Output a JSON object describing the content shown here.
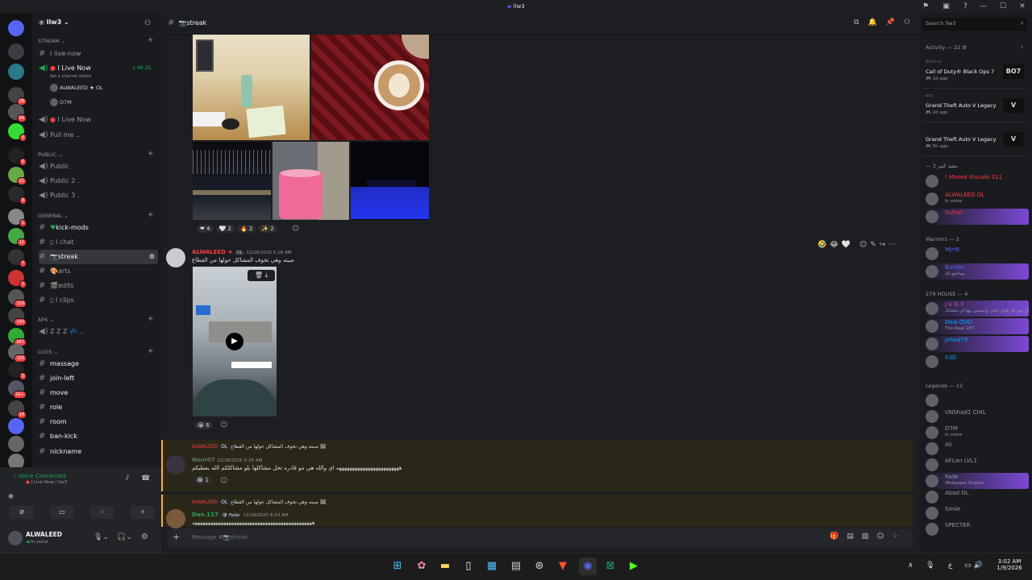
{
  "window": {
    "title": "llw3",
    "controls": [
      "—",
      "☐",
      "✕"
    ]
  },
  "server": {
    "name": "llw3"
  },
  "categories": {
    "stream": "Stream",
    "public": "Public",
    "general": "GENERAL",
    "afk": "AFK",
    "logs": "LOGS"
  },
  "channels": {
    "live_now_1": "I live-now",
    "voice_live": "I Live Now",
    "voice_live_time": "1:48:25",
    "channel_status": "Set a channel status",
    "vu1": "ALWALEED",
    "vu1_tag": "OL",
    "vu2": "D7M",
    "voice_live2": "I Live Now",
    "pull": "Pull me ..",
    "public": "Public",
    "public2": "Public 2 .",
    "public3": "Public 3 .",
    "kickmods": "kick-mods",
    "chat": "I chat",
    "streak": "streak",
    "arts": "arts",
    "edits": "edits",
    "clips": "I clips",
    "zzz": "Z Z Z",
    "massage": "massage",
    "joinleft": "join-left",
    "move": "move",
    "role": "role",
    "room": "room",
    "bankick": "ban-kick",
    "nickname": "nickname"
  },
  "server_badges": [
    "28",
    "64",
    "6",
    "6",
    "21",
    "6",
    "1",
    "11",
    "7",
    "3",
    "219",
    "145",
    "847",
    "103",
    "5",
    "1K+",
    "14"
  ],
  "voice": {
    "status": "Voice Connected",
    "detail": "I Live Now / llw3"
  },
  "user": {
    "name": "ALWALEED",
    "status": "In voice"
  },
  "header": {
    "channel": "streak"
  },
  "search": {
    "placeholder": "Search llw3"
  },
  "messages": {
    "reactions1": [
      {
        "e": "❤",
        "c": "4"
      },
      {
        "e": "🤍",
        "c": "2"
      },
      {
        "e": "🔥",
        "c": "2"
      },
      {
        "e": "✨",
        "c": "2"
      }
    ],
    "m1": {
      "author": "ALWALEED",
      "tag": "OL",
      "time": "12/28/2025 5:16 AM",
      "text": "صيته وهي تخوف المشاكل حولها من القطاع"
    },
    "reactions2": [
      {
        "e": "😭",
        "c": "6"
      }
    ],
    "m2": {
      "ref_author": "ALWALEED",
      "ref_tag": "OL",
      "ref_text": "صيته وهي تخوف المشاكل حولها من القطاع",
      "author": "Noor07",
      "time": "12/28/2025 5:35 AM",
      "text": "ههههههههههههههههههههههههه اي والله هي مو قادره تحل مشاكلها بلو مشاكلكم الله يعطيكم"
    },
    "reactions3": [
      {
        "e": "😂",
        "c": "1"
      }
    ],
    "m3": {
      "ref_author": "ALWALEED",
      "ref_tag": "OL",
      "ref_text": "صيته وهي تخوف المشاكل حولها من القطاع",
      "author": "Dan.117",
      "tag": "Fade",
      "time": "12/28/2025 6:53 AM",
      "text": "ههههههههههههههههههههههههههههههههههههههههههههههه"
    }
  },
  "composer": {
    "placeholder": "Message #📷streak"
  },
  "members": {
    "activity_title": "Activity — 22",
    "activities": [
      {
        "user": "Boshra",
        "game": "Call of Duty® Black Ops 7",
        "time": "1d ago",
        "logo": "BO7"
      },
      {
        "user": "abu",
        "game": "Grand Theft Auto V Legacy",
        "time": "2d ago",
        "logo": "V"
      },
      {
        "user": "...",
        "game": "Grand Theft Auto V Legacy",
        "time": "5h ago",
        "logo": "V"
      }
    ],
    "group1": "— 3 مفيد كبير",
    "g1": [
      {
        "name": "! Mosed Alsuabi",
        "tag": "511",
        "color": "#f23f43"
      },
      {
        "name": "ALWALEED",
        "tag": "OL",
        "sub": "In voice",
        "color": "#f23f43"
      },
      {
        "name": "Sultan",
        "color": "#f23f43"
      }
    ],
    "group2": "Warriors — 2",
    "g2": [
      {
        "name": "Mjrt6",
        "color": "#5865f2"
      },
      {
        "name": "Bander",
        "sub": "وماتنفع لك",
        "color": "#5865f2"
      }
    ],
    "group3": "279 HOUSE — 4",
    "g3": [
      {
        "name": "J U D Y",
        "sub": "أي يوم كل قليل دكتي وأحبيتني يبها لي عشانك",
        "color": "#eb459e"
      },
      {
        "name": "Dew",
        "tag": "OVO",
        "sub": "The Real 187",
        "color": "#00a8fc"
      },
      {
        "name": "Jehod79",
        "color": "#00a8fc"
      },
      {
        "name": "S3D",
        "color": "#00a8fc"
      }
    ],
    "group4": "Legends — 12",
    "g4": [
      {
        "name": "",
        "color": "#dbdee1"
      },
      {
        "name": "UNShad1",
        "tag": "CHIL",
        "color": "#949ba4"
      },
      {
        "name": "D7M",
        "sub": "In voice",
        "color": "#949ba4"
      },
      {
        "name": "Ali",
        "color": "#949ba4"
      },
      {
        "name": "AFLan",
        "tag": "LVL1",
        "color": "#949ba4"
      },
      {
        "name": "Fade",
        "sub": "Wallpaper Engine",
        "color": "#949ba4"
      },
      {
        "name": "Abod",
        "tag": "OL",
        "color": "#949ba4"
      },
      {
        "name": "Smile",
        "color": "#949ba4"
      },
      {
        "name": "SPECTER",
        "color": "#949ba4"
      }
    ]
  },
  "taskbar": {
    "time": "3:02 AM",
    "date": "1/9/2026",
    "lang": "ع"
  }
}
